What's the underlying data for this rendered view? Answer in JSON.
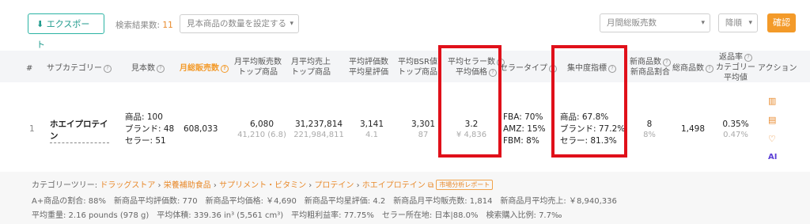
{
  "toolbar": {
    "export_label": "エクスポート",
    "result_label": "検索結果数:",
    "result_count": "11",
    "sample_placeholder": "見本商品の数量を設定する",
    "sort_field": "月間総販売数",
    "sort_order": "降順",
    "confirm_label": "確認"
  },
  "columns": {
    "index": "#",
    "subcategory": "サブカテゴリー",
    "sample": "見本数",
    "monthly_sales": "月総販売数",
    "avg_sales_top": [
      "月平均販売数",
      "トップ商品"
    ],
    "avg_revenue_top": [
      "月平均売上",
      "トップ商品"
    ],
    "avg_reviews": [
      "平均評価数",
      "平均星評価"
    ],
    "avg_bsr": [
      "平均BSR値",
      "トップ商品"
    ],
    "avg_sellers": [
      "平均セラー数",
      "平均価格"
    ],
    "seller_type": "セラータイプ",
    "concentration": "集中度指標",
    "new_products": [
      "新商品数",
      "新商品割合"
    ],
    "total_products": "総商品数",
    "return_rate": [
      "返品率",
      "カテゴリー",
      "平均値"
    ],
    "action": "アクション"
  },
  "row": {
    "index": "1",
    "subcategory": "ホエイプロテイン",
    "sample_products": "商品: 100",
    "sample_brands": "ブランド: 48",
    "sample_sellers": "セラー: 51",
    "monthly_sales": "608,033",
    "avg_sales_top": "6,080",
    "avg_sales_sub": "41,210 (6.8)",
    "avg_revenue_top": "31,237,814",
    "avg_revenue_sub": "221,984,811",
    "avg_reviews": "3,141",
    "avg_stars": "4.1",
    "avg_bsr": "3,301",
    "avg_bsr_sub": "87",
    "avg_sellers": "3.2",
    "avg_price": "¥ 4,836",
    "fba": "FBA: 70%",
    "amz": "AMZ: 15%",
    "fbm": "FBM: 8%",
    "conc_products": "商品: 67.8%",
    "conc_brands": "ブランド: 77.2%",
    "conc_sellers": "セラー: 81.3%",
    "new_products": "8",
    "new_ratio": "8%",
    "total_products": "1,498",
    "return_rate": "0.35%",
    "return_avg": "0.47%"
  },
  "footer": {
    "tree_label": "カテゴリーツリー:",
    "tree": [
      "ドラッグストア",
      "栄養補助食品",
      "サプリメント・ビタミン",
      "プロテイン",
      "ホエイプロテイン"
    ],
    "report_badge": "市場分析レポート",
    "line2": "A+商品の割合: 88%　新商品平均評価数: 770　新商品平均価格: ￥4,690　新商品平均星評価: 4.2　新商品月平均販売数: 1,814　新商品月平均売上: ￥8,940,336",
    "line3": "平均重量: 2.16 pounds (978 g)　平均体積: 339.36 in³ (5,561 cm³)　平均粗利益率: 77.75%　セラー所在地: 日本|88.0%　検索購入比例: 7.7‰"
  },
  "colors": {
    "accent": "#f39a29",
    "teal": "#2bb3a3",
    "highlight": "#e0101a"
  }
}
